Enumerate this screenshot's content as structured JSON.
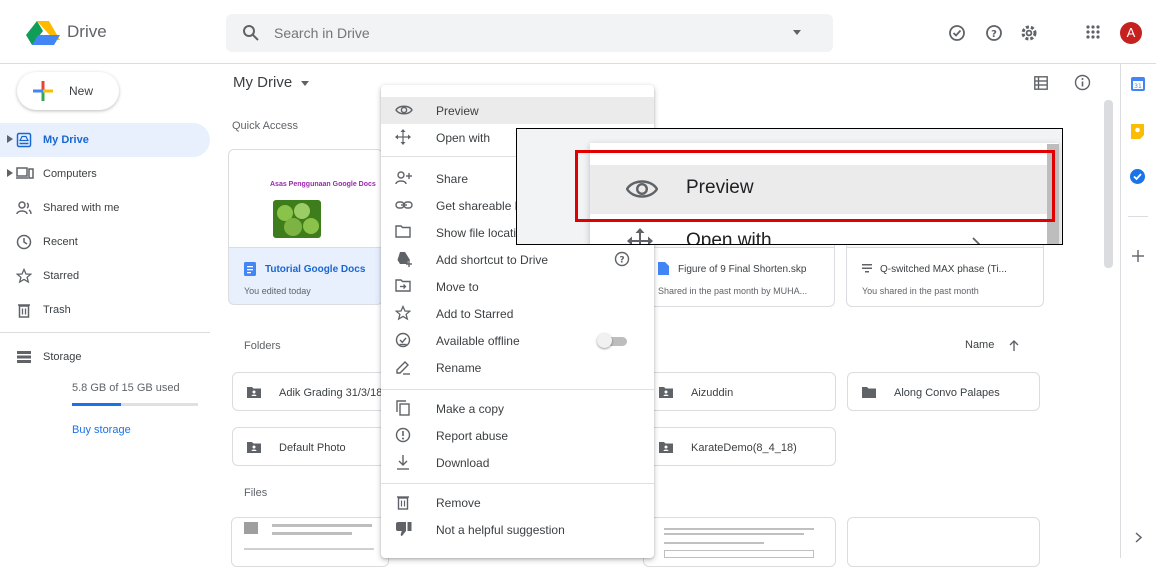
{
  "header": {
    "app_title": "Drive",
    "search_placeholder": "Search in Drive",
    "avatar_letter": "A"
  },
  "sidebar": {
    "new_label": "New",
    "items": [
      {
        "label": "My Drive",
        "icon": "my-drive-icon",
        "active": true
      },
      {
        "label": "Computers",
        "icon": "computers-icon"
      },
      {
        "label": "Shared with me",
        "icon": "shared-icon"
      },
      {
        "label": "Recent",
        "icon": "clock-icon"
      },
      {
        "label": "Starred",
        "icon": "star-icon"
      },
      {
        "label": "Trash",
        "icon": "trash-icon"
      }
    ],
    "storage_label": "Storage",
    "storage_used": "5.8 GB of 15 GB used",
    "storage_fraction": 0.39,
    "buy_storage": "Buy storage"
  },
  "main": {
    "title": "My Drive",
    "quick_access": "Quick Access",
    "quick_cards": [
      {
        "thumb_title": "Asas Penggunaan Google Docs",
        "name": "Tutorial Google Docs",
        "sub": "You edited today"
      },
      {
        "name": "Figure of 9 Final Shorten.skp",
        "sub": "Shared in the past month by MUHA..."
      },
      {
        "name": "Q-switched MAX phase (Ti...",
        "sub": "You shared in the past month"
      }
    ],
    "folders_label": "Folders",
    "sort_label": "Name",
    "folders": [
      "Adik Grading 31/3/18",
      "Aizuddin",
      "Along Convo Palapes",
      "Default Photo",
      "KarateDemo(8_4_18)"
    ],
    "files_label": "Files"
  },
  "context_menu": {
    "items": [
      {
        "label": "Preview",
        "icon": "eye-icon"
      },
      {
        "label": "Open with",
        "icon": "open-with-icon"
      },
      {
        "label": "Share",
        "icon": "share-icon"
      },
      {
        "label": "Get shareable link",
        "icon": "link-icon"
      },
      {
        "label": "Show file location",
        "icon": "folder-icon"
      },
      {
        "label": "Add shortcut to Drive",
        "icon": "add-shortcut-icon"
      },
      {
        "label": "Move to",
        "icon": "move-icon"
      },
      {
        "label": "Add to Starred",
        "icon": "star-icon"
      },
      {
        "label": "Available offline",
        "icon": "offline-icon"
      },
      {
        "label": "Rename",
        "icon": "pencil-icon"
      },
      {
        "label": "Make a copy",
        "icon": "copy-icon"
      },
      {
        "label": "Report abuse",
        "icon": "report-icon"
      },
      {
        "label": "Download",
        "icon": "download-icon"
      },
      {
        "label": "Remove",
        "icon": "trash-icon"
      },
      {
        "label": "Not a helpful suggestion",
        "icon": "thumb-down-icon"
      }
    ]
  },
  "zoom": {
    "preview": "Preview",
    "open_with": "Open with"
  },
  "colors": {
    "accent": "#1a73e8",
    "highlight_box": "#e00000",
    "avatar": "#c5221f"
  }
}
